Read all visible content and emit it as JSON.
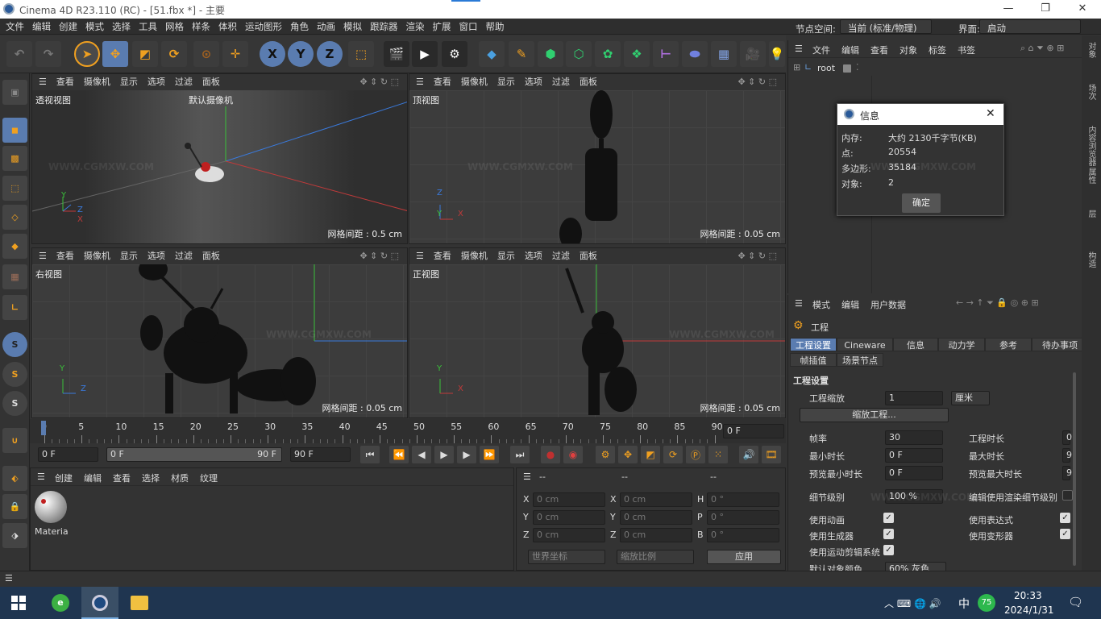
{
  "app": {
    "title": "Cinema 4D R23.110 (RC) - [51.fbx *] - 主要"
  },
  "menu": [
    "文件",
    "编辑",
    "创建",
    "模式",
    "选择",
    "工具",
    "网格",
    "样条",
    "体积",
    "运动图形",
    "角色",
    "动画",
    "模拟",
    "跟踪器",
    "渲染",
    "扩展",
    "窗口",
    "帮助"
  ],
  "layout": {
    "node_space_label": "节点空间:",
    "node_space_value": "当前 (标准/物理)",
    "interface_label": "界面:",
    "interface_value": "启动"
  },
  "toolbar": {
    "xyz": [
      "X",
      "Y",
      "Z"
    ]
  },
  "viewport_menu": [
    "查看",
    "摄像机",
    "显示",
    "选项",
    "过滤",
    "面板"
  ],
  "viewports": [
    {
      "name": "透视视图",
      "camera": "默认摄像机",
      "grid": "网格间距 : 0.5 cm"
    },
    {
      "name": "顶视图",
      "grid": "网格间距 : 0.05 cm"
    },
    {
      "name": "右视图",
      "grid": "网格间距 : 0.05 cm"
    },
    {
      "name": "正视图",
      "grid": "网格间距 : 0.05 cm"
    }
  ],
  "axes": {
    "x": "X",
    "y": "Y",
    "z": "Z"
  },
  "timeline": {
    "ticks": [
      "0",
      "5",
      "10",
      "15",
      "20",
      "25",
      "30",
      "35",
      "40",
      "45",
      "50",
      "55",
      "60",
      "65",
      "70",
      "75",
      "80",
      "85",
      "90"
    ],
    "current": "0 F"
  },
  "transport": {
    "start": "0 F",
    "range_start": "0 F",
    "range_end": "90 F",
    "end": "90 F"
  },
  "material_manager": {
    "menu": [
      "创建",
      "编辑",
      "查看",
      "选择",
      "材质",
      "纹理"
    ],
    "material_name": "Materia"
  },
  "coord_manager": {
    "cols": [
      "--",
      "--",
      "--"
    ],
    "rows": [
      {
        "a": "X",
        "av": "0 cm",
        "b": "X",
        "bv": "0 cm",
        "c": "H",
        "cv": "0 °"
      },
      {
        "a": "Y",
        "av": "0 cm",
        "b": "Y",
        "bv": "0 cm",
        "c": "P",
        "cv": "0 °"
      },
      {
        "a": "Z",
        "av": "0 cm",
        "b": "Z",
        "bv": "0 cm",
        "c": "B",
        "cv": "0 °"
      }
    ],
    "world": "世界坐标",
    "scale": "缩放比例",
    "apply": "应用"
  },
  "object_manager": {
    "menu": [
      "文件",
      "编辑",
      "查看",
      "对象",
      "标签",
      "书签"
    ],
    "root": "root"
  },
  "info_dialog": {
    "title": "信息",
    "rows": [
      {
        "k": "内存:",
        "v": "大约 2130千字节(KB)"
      },
      {
        "k": "点:",
        "v": "20554"
      },
      {
        "k": "多边形:",
        "v": "35184"
      },
      {
        "k": "对象:",
        "v": "2"
      }
    ],
    "ok": "确定"
  },
  "attr_manager": {
    "menu": [
      "模式",
      "编辑",
      "用户数据"
    ],
    "title": "工程",
    "tabs": [
      "工程设置",
      "Cineware",
      "信息",
      "动力学",
      "参考",
      "待办事项"
    ],
    "tabs2": [
      "帧插值",
      "场景节点"
    ],
    "section": "工程设置",
    "scale_label": "工程缩放",
    "scale_value": "1",
    "scale_unit": "厘米",
    "scale_btn": "缩放工程...",
    "fps_label": "帧率",
    "fps_value": "30",
    "len_label": "工程时长",
    "len_value": "0",
    "min_label": "最小时长",
    "min_value": "0 F",
    "max_label": "最大时长",
    "max_value": "9",
    "pmin_label": "预览最小时长",
    "pmin_value": "0 F",
    "pmax_label": "预览最大时长",
    "pmax_value": "9",
    "lod_label": "细节级别",
    "lod_value": "100 %",
    "lod_render": "编辑使用渲染细节级别",
    "anim": "使用动画",
    "expr": "使用表达式",
    "gen": "使用生成器",
    "deform": "使用变形器",
    "motion": "使用运动剪辑系统",
    "defcolor": "默认对象颜色",
    "defcolor_value": "60% 灰色"
  },
  "right_strip": [
    "对象",
    "场次",
    "内容浏览器",
    "属性",
    "层",
    "构造"
  ],
  "taskbar": {
    "time": "20:33",
    "date": "2024/1/31",
    "ime": "中",
    "badge": "75"
  },
  "watermark": "WWW.CGMXW.COM"
}
